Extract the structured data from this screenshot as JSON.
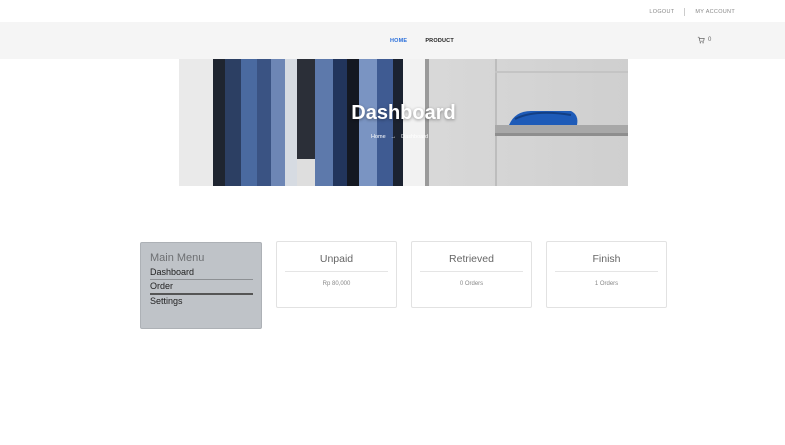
{
  "top_links": {
    "logout": "LOGOUT",
    "account": "MY ACCOUNT"
  },
  "nav": {
    "home": "HOME",
    "product": "PRODUCT",
    "cart_count": "0"
  },
  "hero": {
    "title": "Dashboard",
    "crumb_home": "Home",
    "crumb_arrow": "→",
    "crumb_current": "Dashboard"
  },
  "sidebar": {
    "heading": "Main Menu",
    "items": [
      {
        "label": "Dashboard"
      },
      {
        "label": "Order"
      },
      {
        "label": "Settings"
      }
    ]
  },
  "cards": [
    {
      "title": "Unpaid",
      "value": "Rp 80,000"
    },
    {
      "title": "Retrieved",
      "value": "0 Orders"
    },
    {
      "title": "Finish",
      "value": "1 Orders"
    }
  ],
  "colors": {
    "accent": "#2a6fdb",
    "sidebar_bg": "#bfc3c8",
    "navbar_bg": "#f5f5f5"
  }
}
